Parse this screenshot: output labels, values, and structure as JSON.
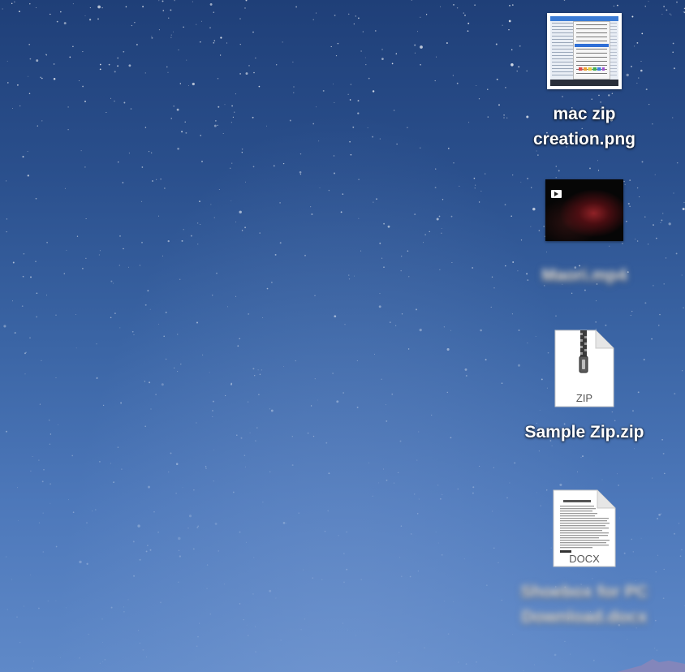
{
  "desktop": {
    "files": [
      {
        "name": "mac zip creation.png",
        "line1": "mac zip",
        "line2": "creation.png",
        "kind": "png-screenshot"
      },
      {
        "name": "Maori.mp4",
        "line1": "Maori.mp4",
        "kind": "video-thumbnail",
        "label_blurred": true
      },
      {
        "name": "Sample Zip.zip",
        "line1": "Sample Zip.zip",
        "kind": "zip-archive",
        "badge": "ZIP"
      },
      {
        "name": "Shoebox for PC Download.docx",
        "line1": "Shoebox for PC",
        "line2": "Download.docx",
        "kind": "docx-document",
        "badge": "DOCX",
        "label_blurred": true
      }
    ]
  },
  "colors": {
    "wallpaper_top": "#1f3f78",
    "wallpaper_bottom": "#5f89c8",
    "label_text": "#ffffff"
  }
}
